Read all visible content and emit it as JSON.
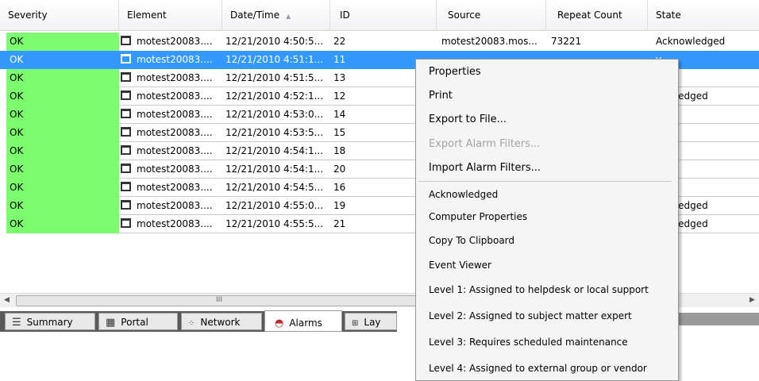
{
  "columns": {
    "severity": "Severity",
    "element": "Element",
    "datetime": "Date/Time",
    "id": "ID",
    "source": "Source",
    "repeat": "Repeat Count",
    "state": "State"
  },
  "colors": {
    "ok_green": "#7cfc6e",
    "selection_blue": "#3399ff"
  },
  "rows": [
    {
      "severity": "OK",
      "element": "motest20083....",
      "datetime": "12/21/2010 4:50:5...",
      "id": "22",
      "source": "motest20083.mos...",
      "repeat": "73221",
      "state": "Acknowledged"
    },
    {
      "severity": "OK",
      "element": "motest20083....",
      "datetime": "12/21/2010 4:51:1...",
      "id": "11",
      "source": "",
      "repeat": "",
      "state": "y"
    },
    {
      "severity": "OK",
      "element": "motest20083....",
      "datetime": "12/21/2010 4:51:5...",
      "id": "13",
      "source": "",
      "repeat": "",
      "state": "y"
    },
    {
      "severity": "OK",
      "element": "motest20083....",
      "datetime": "12/21/2010 4:52:1...",
      "id": "12",
      "source": "",
      "repeat": "",
      "state": "nowledged"
    },
    {
      "severity": "OK",
      "element": "motest20083....",
      "datetime": "12/21/2010 4:53:0...",
      "id": "14",
      "source": "",
      "repeat": "",
      "state": "y"
    },
    {
      "severity": "OK",
      "element": "motest20083....",
      "datetime": "12/21/2010 4:53:5...",
      "id": "15",
      "source": "",
      "repeat": "",
      "state": "/"
    },
    {
      "severity": "OK",
      "element": "motest20083....",
      "datetime": "12/21/2010 4:54:1...",
      "id": "18",
      "source": "",
      "repeat": "",
      "state": "/"
    },
    {
      "severity": "OK",
      "element": "motest20083....",
      "datetime": "12/21/2010 4:54:1...",
      "id": "20",
      "source": "",
      "repeat": "",
      "state": "/"
    },
    {
      "severity": "OK",
      "element": "motest20083....",
      "datetime": "12/21/2010 4:54:5...",
      "id": "16",
      "source": "",
      "repeat": "",
      "state": "/"
    },
    {
      "severity": "OK",
      "element": "motest20083....",
      "datetime": "12/21/2010 4:55:0...",
      "id": "19",
      "source": "",
      "repeat": "",
      "state": "nowledged"
    },
    {
      "severity": "OK",
      "element": "motest20083....",
      "datetime": "12/21/2010 4:55:5...",
      "id": "21",
      "source": "",
      "repeat": "",
      "state": "nowledged"
    }
  ],
  "scrollbar": {
    "thumb_grip": "III"
  },
  "tabs": [
    {
      "label": "Summary",
      "icon": "list-icon"
    },
    {
      "label": "Portal",
      "icon": "grid-icon"
    },
    {
      "label": "Network",
      "icon": "network-icon"
    },
    {
      "label": "Alarms",
      "icon": "alarm-icon"
    },
    {
      "label": "Lay",
      "icon": "layout-icon"
    }
  ],
  "context_menu": {
    "items": [
      {
        "label": "Properties",
        "disabled": false
      },
      {
        "label": "Print",
        "disabled": false
      },
      {
        "label": "Export to File...",
        "disabled": false
      },
      {
        "label": "Export Alarm Filters...",
        "disabled": true
      },
      {
        "label": "Import Alarm Filters...",
        "disabled": false
      }
    ],
    "sub_items": [
      {
        "label": "Acknowledged"
      },
      {
        "label": "Computer Properties"
      },
      {
        "label": "Copy To Clipboard"
      },
      {
        "label": "Event Viewer"
      },
      {
        "label": "Level 1: Assigned to helpdesk or local support"
      },
      {
        "label": "Level 2: Assigned to subject matter expert"
      },
      {
        "label": "Level 3: Requires scheduled maintenance"
      },
      {
        "label": "Level 4: Assigned to external group or vendor"
      }
    ]
  }
}
